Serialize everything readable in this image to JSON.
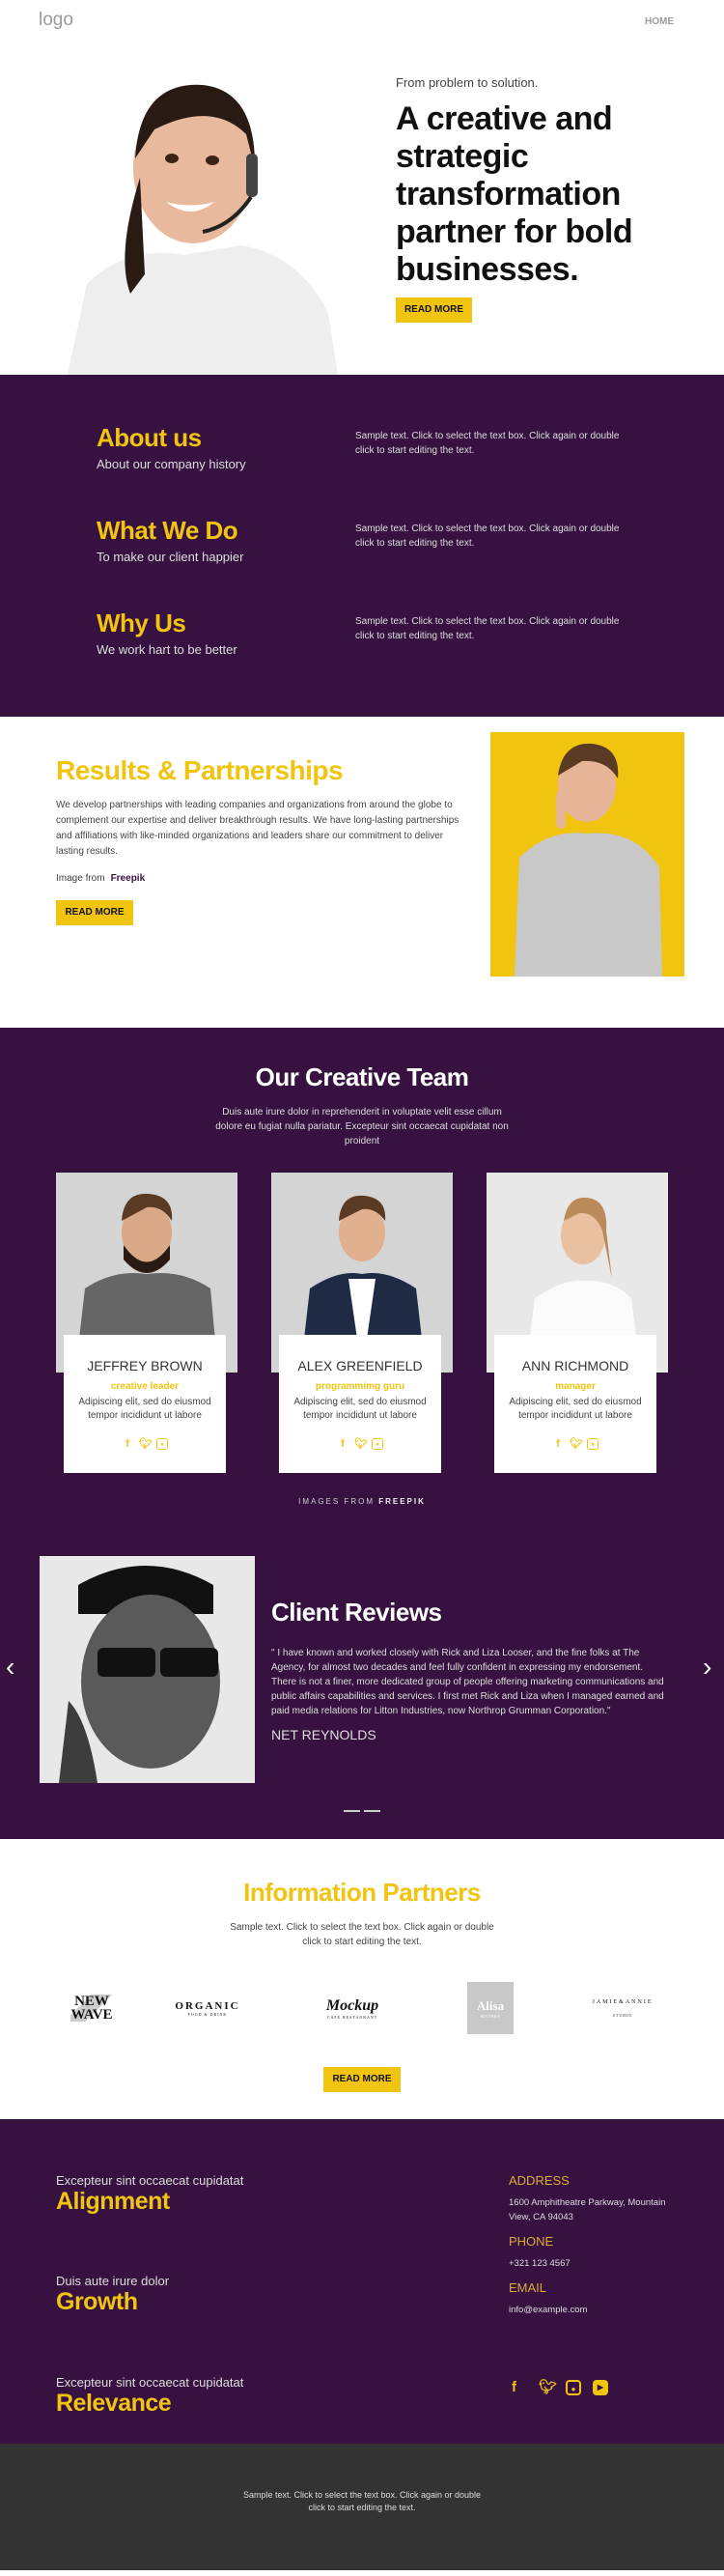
{
  "header": {
    "logo": "logo",
    "nav": [
      {
        "label": "HOME"
      }
    ]
  },
  "hero": {
    "subtitle": "From problem to solution.",
    "title": "A creative and strategic transformation partner for bold businesses.",
    "button": "READ MORE",
    "image": "woman with headset"
  },
  "about": {
    "items": [
      {
        "title": "About us",
        "subtitle": "About our company history",
        "text": "Sample text. Click to select the text box. Click again or double click to start editing the text."
      },
      {
        "title": "What We Do",
        "subtitle": "To make our client happier",
        "text": "Sample text. Click to select the text box. Click again or double click to start editing the text."
      },
      {
        "title": "Why Us",
        "subtitle": "We work hart to be better",
        "text": "Sample text. Click to select the text box. Click again or double click to start editing the text."
      }
    ]
  },
  "results": {
    "title": "Results & Partnerships",
    "body": "We develop partnerships with leading companies and organizations from around the globe to complement our expertise and deliver breakthrough results. We have long-lasting partnerships and affiliations with like-minded organizations and leaders share our commitment to deliver lasting results.",
    "credit_prefix": "Image from",
    "credit_link": "Freepik",
    "button": "READ MORE"
  },
  "team": {
    "title": "Our Creative Team",
    "intro": "Duis aute irure dolor in reprehenderit in voluptate velit esse cillum dolore eu fugiat nulla pariatur. Excepteur sint occaecat cupidatat non proident",
    "members": [
      {
        "name": "JEFFREY BROWN",
        "role": "creative leader",
        "desc": "Adipiscing elit, sed do eiusmod tempor incididunt ut labore"
      },
      {
        "name": "ALEX GREENFIELD",
        "role": "programmimg guru",
        "desc": "Adipiscing elit, sed do eiusmod tempor incididunt ut labore"
      },
      {
        "name": "ANN RICHMOND",
        "role": "manager",
        "desc": "Adipiscing elit, sed do eiusmod tempor incididunt ut labore"
      }
    ],
    "credit_prefix": "IMAGES FROM",
    "credit_link": "FREEPIK"
  },
  "reviews": {
    "title": "Client Reviews",
    "quote": "\" I have known and worked closely with Rick and Liza Looser, and the fine folks at The Agency, for almost two decades and feel fully confident in expressing my endorsement. There is not a finer, more dedicated group of people offering marketing communications and public affairs capabilities and services. I first met Rick and Liza when I managed earned and paid media relations for Litton Industries, now Northrop Grumman Corporation.\"",
    "author": "NET REYNOLDS",
    "prev": "‹",
    "next": "›"
  },
  "partners": {
    "title": "Information Partners",
    "intro": "Sample text. Click to select the text box. Click again or double click to start editing the text.",
    "logos": [
      {
        "name": "NEW WAVE"
      },
      {
        "name": "ORGANIC",
        "sub": "FOOD & DRINK"
      },
      {
        "name": "Mockup",
        "sub": "CAFE RESTAURANT"
      },
      {
        "name": "Alisa",
        "sub": "BOUTIQUE"
      },
      {
        "name": "JAMIE&ANNIE",
        "sub": "STUDIO"
      }
    ],
    "button": "READ MORE"
  },
  "footer": {
    "items": [
      {
        "subtitle": "Excepteur sint occaecat cupidatat",
        "title": "Alignment"
      },
      {
        "subtitle": "Duis aute irure dolor",
        "title": "Growth"
      },
      {
        "subtitle": "Excepteur sint occaecat cupidatat",
        "title": "Relevance"
      }
    ],
    "address_label": "ADDRESS",
    "address": "1600 Amphitheatre Parkway, Mountain View, CA 94043",
    "phone_label": "PHONE",
    "phone": "+321 123 4567",
    "email_label": "EMAIL",
    "email": "info@example.com",
    "bottom_text": "Sample text. Click to select the text box. Click again or double click to start editing the text."
  },
  "colors": {
    "purple": "#371241",
    "yellow": "#f1c40f",
    "dark": "#333333"
  }
}
